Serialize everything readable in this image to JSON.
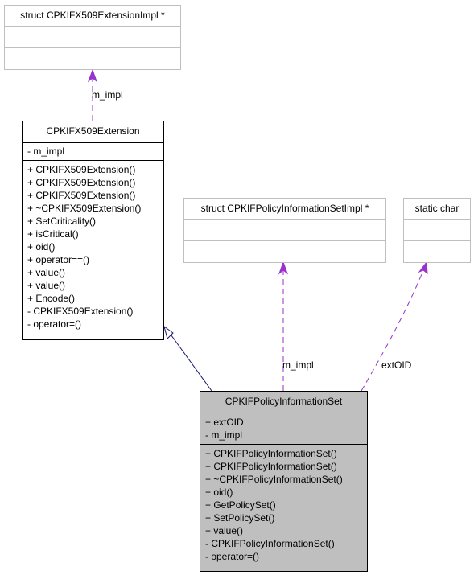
{
  "diagram": {
    "type": "collaboration-diagram",
    "colors": {
      "usage_edge": "#9a32cd",
      "inheritance_edge": "#191970",
      "focus_fill": "#bfbfbf",
      "external_border": "#bfbfbf"
    },
    "nodes": {
      "ext_impl": {
        "title": "struct CPKIFX509ExtensionImpl *",
        "attributes": [],
        "methods": []
      },
      "x509_extension": {
        "title": "CPKIFX509Extension",
        "attributes": [
          "- m_impl"
        ],
        "methods": [
          "+ CPKIFX509Extension()",
          "+ CPKIFX509Extension()",
          "+ CPKIFX509Extension()",
          "+ ~CPKIFX509Extension()",
          "+ SetCriticality()",
          "+ isCritical()",
          "+ oid()",
          "+ operator==()",
          "+ value()",
          "+ value()",
          "+ Encode()",
          "- CPKIFX509Extension()",
          "- operator=()"
        ]
      },
      "policy_impl": {
        "title": "struct CPKIFPolicyInformationSetImpl *",
        "attributes": [],
        "methods": []
      },
      "static_char": {
        "title": "static char",
        "attributes": [],
        "methods": []
      },
      "policy_set": {
        "title": "CPKIFPolicyInformationSet",
        "attributes": [
          "+ extOID",
          "- m_impl"
        ],
        "methods": [
          "+ CPKIFPolicyInformationSet()",
          "+ CPKIFPolicyInformationSet()",
          "+ ~CPKIFPolicyInformationSet()",
          "+ oid()",
          "+ GetPolicySet()",
          "+ SetPolicySet()",
          "+ value()",
          "- CPKIFPolicyInformationSet()",
          "- operator=()"
        ]
      }
    },
    "edges": [
      {
        "from": "x509_extension",
        "to": "ext_impl",
        "kind": "usage",
        "label": "m_impl"
      },
      {
        "from": "policy_set",
        "to": "x509_extension",
        "kind": "inheritance",
        "label": ""
      },
      {
        "from": "policy_set",
        "to": "policy_impl",
        "kind": "usage",
        "label": "m_impl"
      },
      {
        "from": "policy_set",
        "to": "static_char",
        "kind": "usage",
        "label": "extOID"
      }
    ]
  }
}
